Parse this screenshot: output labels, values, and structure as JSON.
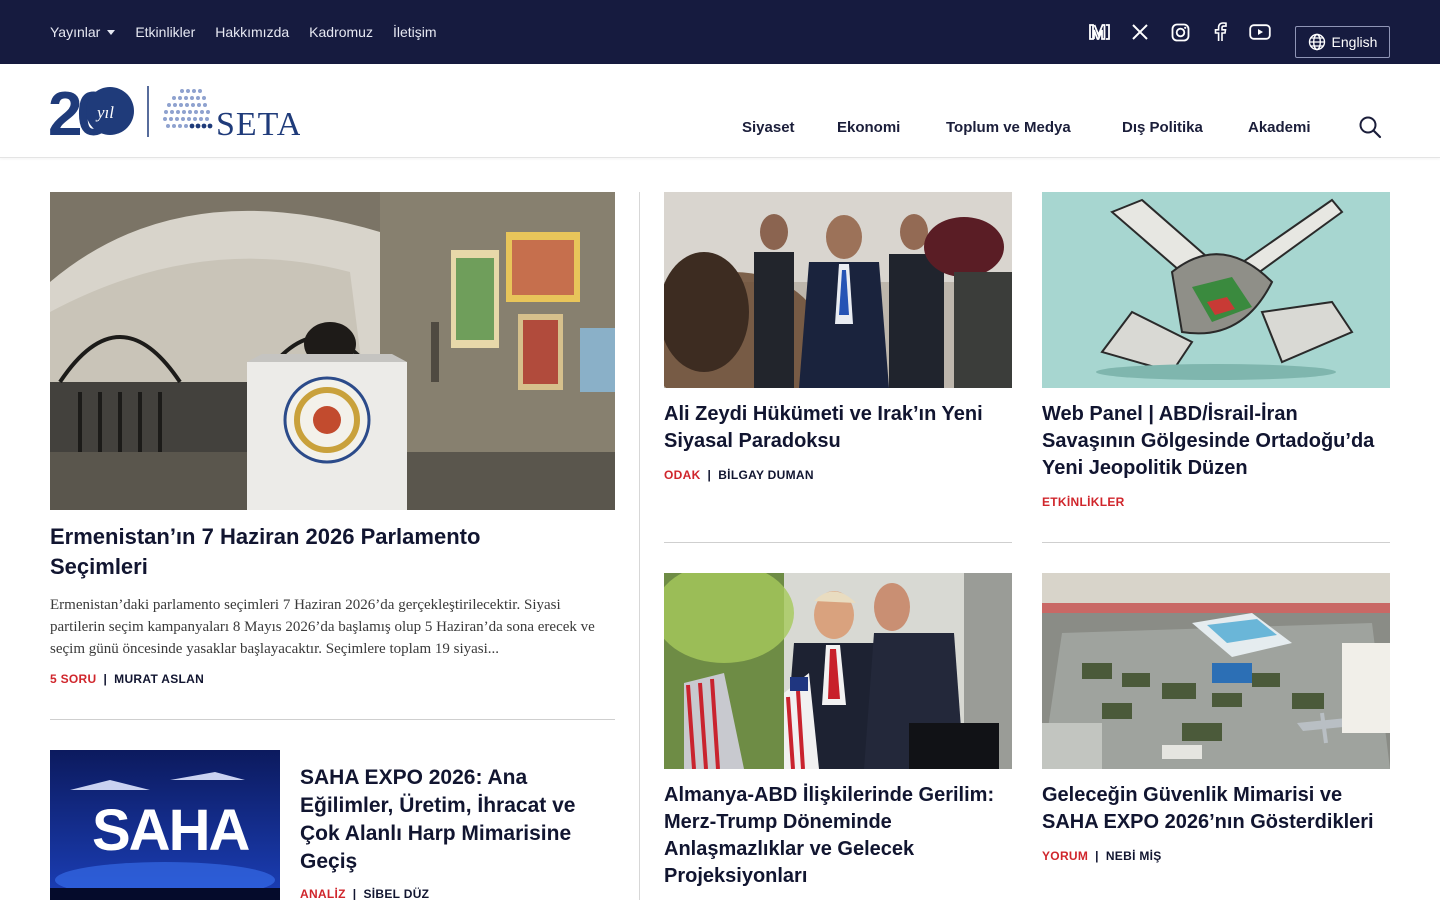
{
  "topbar": {
    "nav": [
      "Yayınlar",
      "Etkinlikler",
      "Hakkımızda",
      "Kadromuz",
      "İletişim"
    ],
    "social_icons": [
      "medium-icon",
      "x-icon",
      "instagram-icon",
      "facebook-icon",
      "youtube-icon"
    ],
    "language": "English"
  },
  "header": {
    "logo_badge": "20",
    "logo_badge_sub": "yıl",
    "logo_text": "SETA",
    "nav": [
      "Siyaset",
      "Ekonomi",
      "Toplum ve Medya",
      "Dış Politika",
      "Akademi"
    ]
  },
  "articles": {
    "featured": {
      "title": "Ermenistan’ın 7 Haziran 2026 Parlamento Seçimleri",
      "excerpt": "Ermenistan’daki parlamento seçimleri 7 Haziran 2026’da gerçekleştirilecektir. Siyasi partilerin seçim kampanyaları 8 Mayıs 2026’da başlamış olup 5 Haziran’da sona erecek ve seçim günü öncesinde yasaklar başlayacaktır. Seçimlere toplam 19 siyasi...",
      "category": "5 SORU",
      "author": "MURAT ASLAN"
    },
    "secondary": {
      "title": "SAHA EXPO 2026: Ana Eğilimler, Üretim, İhracat ve Çok Alanlı Harp Mimarisine Geçiş",
      "category": "ANALİZ",
      "author": "SİBEL DÜZ",
      "image_text": "SAHA"
    },
    "card1": {
      "title": "Ali Zeydi Hükümeti ve Irak’ın Yeni Siyasal Paradoksu",
      "category": "ODAK",
      "author": "BİLGAY DUMAN"
    },
    "card2": {
      "title": "Web Panel | ABD/İsrail-İran Savaşının Gölgesinde Ortadoğu’da Yeni Jeopolitik Düzen",
      "category": "ETKİNLİKLER"
    },
    "card3": {
      "title": "Almanya-ABD İlişkilerinde Gerilim: Merz-Trump Döneminde Anlaşmazlıklar ve Gelecek Projeksiyonları"
    },
    "card4": {
      "title": "Geleceğin Güvenlik Mimarisi ve SAHA EXPO 2026’nın Gösterdikleri",
      "category": "YORUM",
      "author": "NEBİ MİŞ"
    }
  },
  "colors": {
    "navy": "#161b3f",
    "accent_red": "#d0262c",
    "logo_blue": "#1f3b7a"
  }
}
